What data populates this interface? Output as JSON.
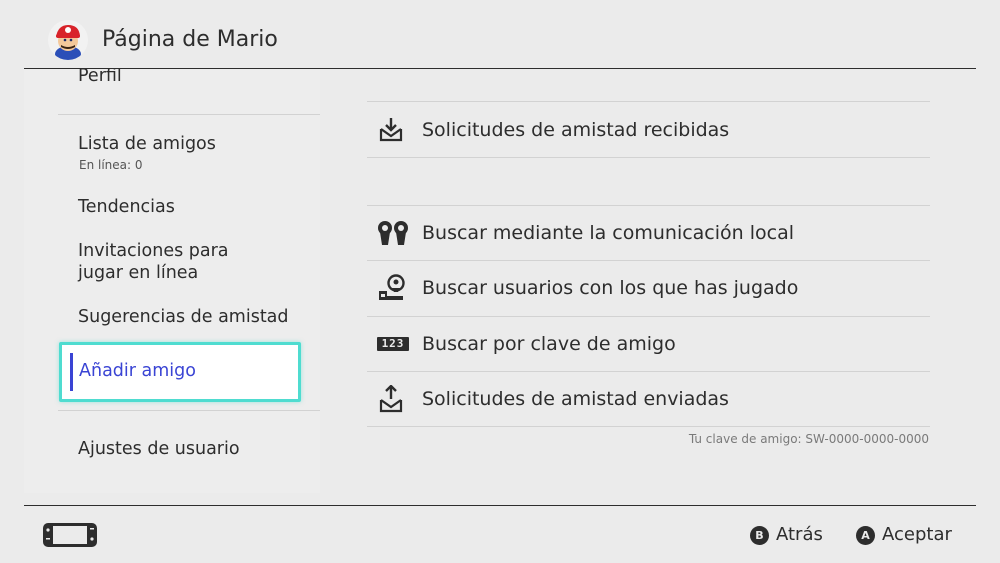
{
  "header": {
    "title": "Página de Mario",
    "avatar_icon": "mario-avatar"
  },
  "sidebar": {
    "items": [
      {
        "label": "Perfil"
      },
      {
        "label": "Lista de amigos",
        "sub": "En línea: 0"
      },
      {
        "label": "Tendencias"
      },
      {
        "label": "Invitaciones para",
        "label2": "jugar en línea"
      },
      {
        "label": "Sugerencias de amistad"
      },
      {
        "label": "Añadir amigo",
        "selected": true
      },
      {
        "label": "Ajustes de usuario"
      }
    ]
  },
  "main": {
    "items": [
      {
        "label": "Solicitudes de amistad recibidas",
        "icon": "inbox-download-icon"
      },
      {
        "label": "Buscar mediante la comunicación local",
        "icon": "local-users-icon"
      },
      {
        "label": "Buscar usuarios con los que has jugado",
        "icon": "played-with-icon"
      },
      {
        "label": "Buscar por clave de amigo",
        "icon": "friend-code-icon",
        "icon_text": "123"
      },
      {
        "label": "Solicitudes de amistad enviadas",
        "icon": "outbox-upload-icon"
      }
    ],
    "friend_code": "Tu clave de amigo: SW-0000-0000-0000"
  },
  "footer": {
    "console_icon": "switch-console-icon",
    "back": {
      "key": "B",
      "label": "Atrás"
    },
    "accept": {
      "key": "A",
      "label": "Aceptar"
    }
  },
  "colors": {
    "background": "#ebebeb",
    "selection_border": "#4fdcd0",
    "selection_accent": "#3a44d4",
    "text": "#2d2d2d"
  }
}
